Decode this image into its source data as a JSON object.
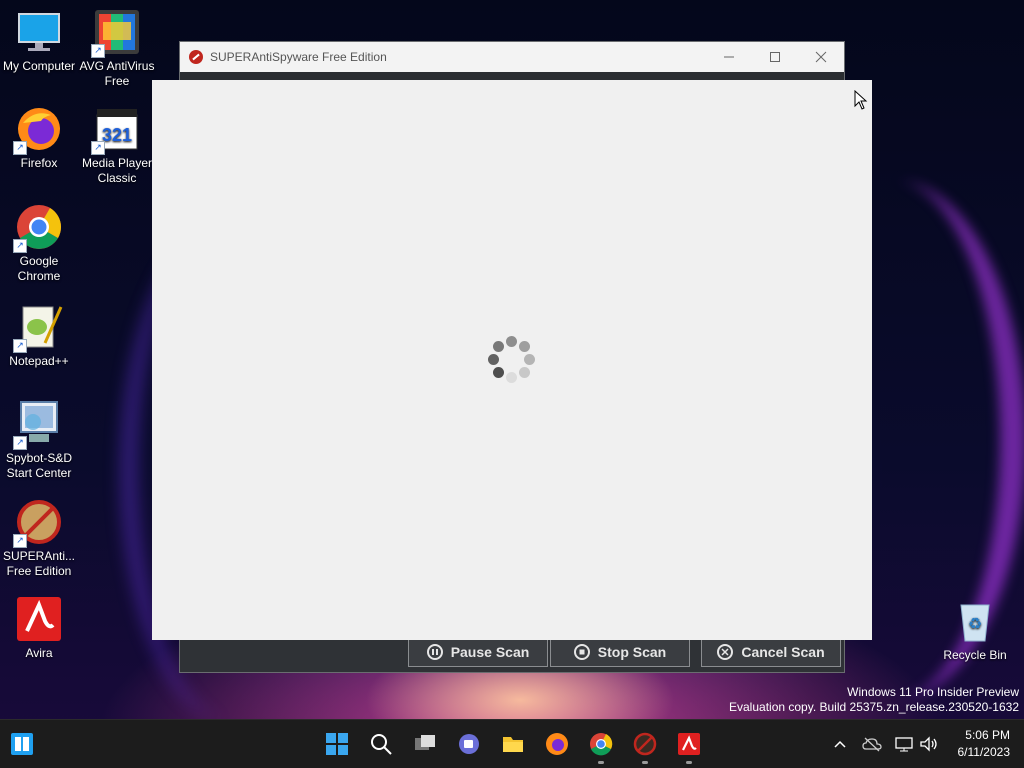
{
  "desktop": {
    "icons": [
      {
        "label": "My Computer",
        "icon": "monitor-icon"
      },
      {
        "label": "AVG AntiVirus Free",
        "icon": "avg-icon"
      },
      {
        "label": "Firefox",
        "icon": "firefox-icon"
      },
      {
        "label": "Media Player Classic",
        "icon": "mpc-icon",
        "badge": "321"
      },
      {
        "label": "Google Chrome",
        "icon": "chrome-icon"
      },
      {
        "label": "Notepad++",
        "icon": "notepadpp-icon"
      },
      {
        "label": "Spybot-S&D Start Center",
        "icon": "spybot-icon"
      },
      {
        "label": "SUPERAnti... Free Edition",
        "icon": "superantispyware-icon"
      },
      {
        "label": "Avira",
        "icon": "avira-icon"
      },
      {
        "label": "Recycle Bin",
        "icon": "recycle-bin-icon"
      }
    ]
  },
  "sas_window": {
    "title": "SUPERAntiSpyware Free Edition",
    "buttons": {
      "pause": "Pause Scan",
      "stop": "Stop Scan",
      "cancel": "Cancel Scan"
    }
  },
  "watermark": {
    "line1": "Windows 11 Pro Insider Preview",
    "line2": "Evaluation copy. Build 25375.zn_release.230520-1632"
  },
  "taskbar": {
    "time": "5:06 PM",
    "date": "6/11/2023",
    "colors": {
      "background": "#1c1c1c",
      "accent": "#1fa0f0"
    }
  }
}
